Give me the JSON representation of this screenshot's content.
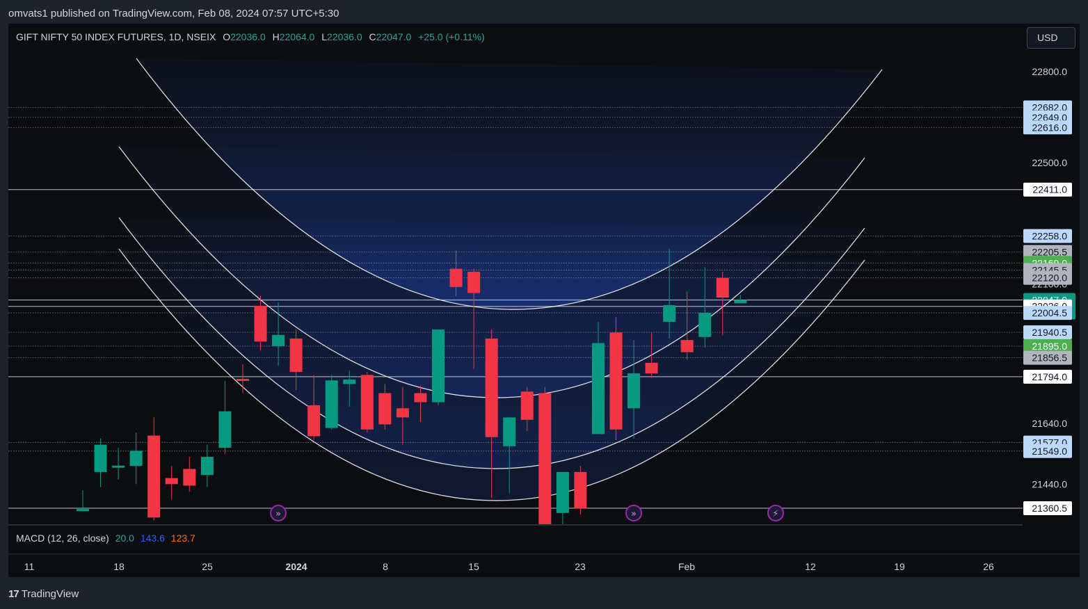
{
  "header": {
    "published": "omvats1 published on TradingView.com, Feb 08, 2024 07:57 UTC+5:30"
  },
  "legend": {
    "symbol": "GIFT NIFTY 50 INDEX FUTURES, 1D, NSEIX",
    "o_label": "O",
    "o": "22036.0",
    "h_label": "H",
    "h": "22064.0",
    "l_label": "L",
    "l": "22036.0",
    "c_label": "C",
    "c": "22047.0",
    "change": "+25.0 (+0.11%)"
  },
  "currency_button": "USD",
  "macd": {
    "label": "MACD (12, 26, close)",
    "v1": "20.0",
    "v2": "143.6",
    "v3": "123.7",
    "colors": {
      "macd": "#26a69a",
      "signal": "#2962ff",
      "hist": "#ff6d00"
    }
  },
  "footer": {
    "brand": "TradingView",
    "logo": "17"
  },
  "colors": {
    "up": "#089981",
    "down": "#f23645",
    "background": "#0c0d10",
    "arc": "#ffffff",
    "fill": "#2962ff"
  },
  "chart_data": {
    "type": "candlestick",
    "y_axis_ticks": [
      "22800.0",
      "22500.0",
      "22100.0",
      "21640.0",
      "21440.0"
    ],
    "x_axis_ticks": [
      "11",
      "18",
      "25",
      "2024",
      "8",
      "15",
      "23",
      "Feb",
      "12",
      "19",
      "26"
    ],
    "price_labels": [
      {
        "value": "22682.0",
        "style": "blue"
      },
      {
        "value": "22649.0",
        "style": "blue"
      },
      {
        "value": "22616.0",
        "style": "blue"
      },
      {
        "value": "22411.0",
        "style": "white"
      },
      {
        "value": "22258.0",
        "style": "blue"
      },
      {
        "value": "22205.5",
        "style": "gray"
      },
      {
        "value": "22169.0",
        "style": "green"
      },
      {
        "value": "22145.5",
        "style": "gray"
      },
      {
        "value": "22120.0",
        "style": "gray"
      },
      {
        "value": "22047.0",
        "style": "current"
      },
      {
        "value": "22026.0",
        "style": "white"
      },
      {
        "value": "22004.5",
        "style": "blue"
      },
      {
        "value": "21940.5",
        "style": "blue"
      },
      {
        "value": "21895.0",
        "style": "green"
      },
      {
        "value": "21856.5",
        "style": "gray"
      },
      {
        "value": "21794.0",
        "style": "white"
      },
      {
        "value": "21577.0",
        "style": "blue"
      },
      {
        "value": "21549.0",
        "style": "blue"
      },
      {
        "value": "21360.5",
        "style": "white"
      }
    ],
    "countdown": "18:52:04",
    "candles": [
      {
        "o": 21355,
        "h": 21420,
        "l": 21350,
        "c": 21358
      },
      {
        "o": 21480,
        "h": 21590,
        "l": 21430,
        "c": 21570
      },
      {
        "o": 21499,
        "h": 21560,
        "l": 21455,
        "c": 21501
      },
      {
        "o": 21500,
        "h": 21610,
        "l": 21440,
        "c": 21550
      },
      {
        "o": 21600,
        "h": 21660,
        "l": 21320,
        "c": 21330
      },
      {
        "o": 21460,
        "h": 21500,
        "l": 21390,
        "c": 21440
      },
      {
        "o": 21490,
        "h": 21530,
        "l": 21415,
        "c": 21435
      },
      {
        "o": 21470,
        "h": 21570,
        "l": 21430,
        "c": 21530
      },
      {
        "o": 21560,
        "h": 21780,
        "l": 21540,
        "c": 21680
      },
      {
        "o": 21787,
        "h": 21835,
        "l": 21740,
        "c": 21782
      },
      {
        "o": 22028,
        "h": 22060,
        "l": 21880,
        "c": 21910
      },
      {
        "o": 21895,
        "h": 22040,
        "l": 21830,
        "c": 21932
      },
      {
        "o": 21920,
        "h": 21950,
        "l": 21750,
        "c": 21810
      },
      {
        "o": 21700,
        "h": 21800,
        "l": 21585,
        "c": 21598
      },
      {
        "o": 21625,
        "h": 21800,
        "l": 21620,
        "c": 21782
      },
      {
        "o": 21770,
        "h": 21815,
        "l": 21695,
        "c": 21785
      },
      {
        "o": 21800,
        "h": 21810,
        "l": 21610,
        "c": 21620
      },
      {
        "o": 21740,
        "h": 21770,
        "l": 21620,
        "c": 21637
      },
      {
        "o": 21690,
        "h": 21760,
        "l": 21570,
        "c": 21660
      },
      {
        "o": 21740,
        "h": 21765,
        "l": 21645,
        "c": 21710
      },
      {
        "o": 21710,
        "h": 21820,
        "l": 21700,
        "c": 21950
      },
      {
        "o": 22150,
        "h": 22210,
        "l": 22060,
        "c": 22090
      },
      {
        "o": 22140,
        "h": 22150,
        "l": 21820,
        "c": 22070
      },
      {
        "o": 21920,
        "h": 21950,
        "l": 21395,
        "c": 21595
      },
      {
        "o": 21565,
        "h": 21650,
        "l": 21410,
        "c": 21660
      },
      {
        "o": 21745,
        "h": 21760,
        "l": 21615,
        "c": 21652
      },
      {
        "o": 21740,
        "h": 21760,
        "l": 21300,
        "c": 21300
      },
      {
        "o": 21345,
        "h": 21470,
        "l": 21270,
        "c": 21480
      },
      {
        "o": 21480,
        "h": 21500,
        "l": 21340,
        "c": 21360
      },
      {
        "o": 21605,
        "h": 21975,
        "l": 21605,
        "c": 21905
      },
      {
        "o": 21940,
        "h": 21990,
        "l": 21585,
        "c": 21620
      },
      {
        "o": 21690,
        "h": 21915,
        "l": 21590,
        "c": 21805
      },
      {
        "o": 21840,
        "h": 21940,
        "l": 21790,
        "c": 21805
      },
      {
        "o": 21975,
        "h": 22215,
        "l": 21920,
        "c": 22030
      },
      {
        "o": 21915,
        "h": 22075,
        "l": 21850,
        "c": 21875
      },
      {
        "o": 21925,
        "h": 22155,
        "l": 21890,
        "c": 22005
      },
      {
        "o": 22120,
        "h": 22140,
        "l": 21930,
        "c": 22055
      },
      {
        "o": 22036,
        "h": 22064,
        "l": 22036,
        "c": 22047
      }
    ]
  }
}
